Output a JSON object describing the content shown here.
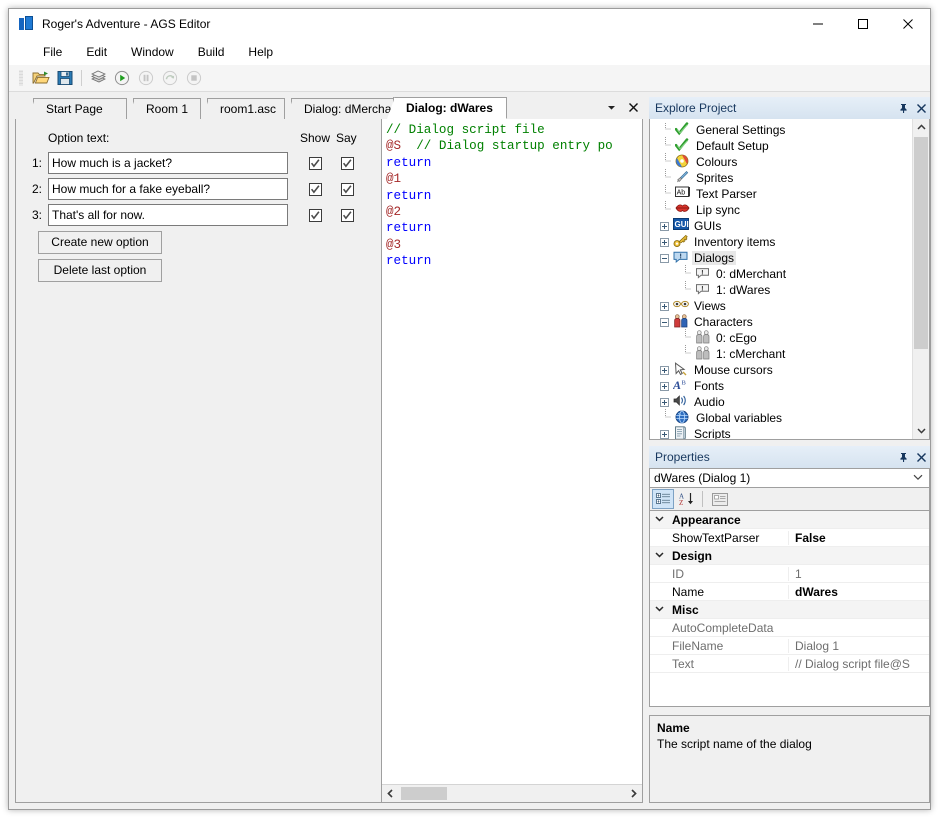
{
  "window": {
    "title": "Roger's Adventure - AGS Editor",
    "icon": "ags-logo-icon",
    "controls": [
      {
        "name": "minimize-button",
        "glyph": "minimize-icon"
      },
      {
        "name": "maximize-button",
        "glyph": "maximize-icon"
      },
      {
        "name": "close-button",
        "glyph": "close-icon"
      }
    ]
  },
  "menubar": {
    "items": [
      {
        "label": "File"
      },
      {
        "label": "Edit"
      },
      {
        "label": "Window"
      },
      {
        "label": "Build"
      },
      {
        "label": "Help"
      }
    ]
  },
  "toolbar": {
    "buttons": [
      {
        "name": "open-project-button",
        "icon": "folder-open-icon",
        "enabled": true
      },
      {
        "name": "save-button",
        "icon": "floppy-disk-icon",
        "enabled": true
      },
      {
        "name": "build-button",
        "icon": "build-blocks-icon",
        "enabled": true
      },
      {
        "name": "run-button",
        "icon": "play-icon",
        "enabled": true
      },
      {
        "name": "pause-button",
        "icon": "pause-icon",
        "enabled": false
      },
      {
        "name": "step-button",
        "icon": "step-over-icon",
        "enabled": false
      },
      {
        "name": "stop-button",
        "icon": "stop-icon",
        "enabled": false
      }
    ]
  },
  "tabs": {
    "items": [
      {
        "label": "Start Page",
        "active": false
      },
      {
        "label": "Room 1",
        "active": false
      },
      {
        "label": "room1.asc",
        "active": false
      },
      {
        "label": "Dialog: dMerchant",
        "active": false
      },
      {
        "label": "Dialog: dWares",
        "active": true
      }
    ],
    "dropdown_icon": "chevron-down-icon",
    "close_icon": "close-icon"
  },
  "dialog_editor": {
    "option_text_header": "Option text:",
    "show_column": "Show",
    "say_column": "Say",
    "options": [
      {
        "number": "1:",
        "text": "How much is a jacket?",
        "show": true,
        "say": true
      },
      {
        "number": "2:",
        "text": "How much for a fake eyeball?",
        "show": true,
        "say": true
      },
      {
        "number": "3:",
        "text": "That's all for now.",
        "show": true,
        "say": true
      }
    ],
    "create_button": "Create new option",
    "delete_button": "Delete last option"
  },
  "script": {
    "lines": [
      {
        "segments": [
          {
            "t": "// Dialog script file",
            "c": "c-comment"
          }
        ]
      },
      {
        "segments": [
          {
            "t": "@S",
            "c": "c-at"
          },
          {
            "t": "  ",
            "c": ""
          },
          {
            "t": "// Dialog startup entry po",
            "c": "c-comment"
          }
        ]
      },
      {
        "segments": [
          {
            "t": "return",
            "c": "c-kw"
          }
        ]
      },
      {
        "segments": [
          {
            "t": "@1",
            "c": "c-at"
          }
        ]
      },
      {
        "segments": [
          {
            "t": "return",
            "c": "c-kw"
          }
        ]
      },
      {
        "segments": [
          {
            "t": "@2",
            "c": "c-at"
          }
        ]
      },
      {
        "segments": [
          {
            "t": "return",
            "c": "c-kw"
          }
        ]
      },
      {
        "segments": [
          {
            "t": "@3",
            "c": "c-at"
          }
        ]
      },
      {
        "segments": [
          {
            "t": "return",
            "c": "c-kw"
          }
        ]
      }
    ],
    "hscroll_left_icon": "chevron-left-icon",
    "hscroll_right_icon": "chevron-right-icon"
  },
  "explore_project": {
    "title": "Explore Project",
    "pin_icon": "pin-icon",
    "close_icon": "close-icon",
    "scroll_up_icon": "chevron-up-icon",
    "scroll_down_icon": "chevron-down-icon",
    "nodes": [
      {
        "label": "General Settings",
        "icon": "green-check-icon",
        "depth": 1,
        "expander": "none",
        "selected": false
      },
      {
        "label": "Default Setup",
        "icon": "green-check-icon",
        "depth": 1,
        "expander": "none",
        "selected": false
      },
      {
        "label": "Colours",
        "icon": "color-palette-icon",
        "depth": 1,
        "expander": "none",
        "selected": false
      },
      {
        "label": "Sprites",
        "icon": "paintbrush-icon",
        "depth": 1,
        "expander": "none",
        "selected": false
      },
      {
        "label": "Text Parser",
        "icon": "text-parser-icon",
        "depth": 1,
        "expander": "none",
        "selected": false
      },
      {
        "label": "Lip sync",
        "icon": "lips-icon",
        "depth": 1,
        "expander": "none",
        "selected": false
      },
      {
        "label": "GUIs",
        "icon": "gui-icon",
        "depth": 1,
        "expander": "plus",
        "selected": false
      },
      {
        "label": "Inventory items",
        "icon": "key-icon",
        "depth": 1,
        "expander": "plus",
        "selected": false
      },
      {
        "label": "Dialogs",
        "icon": "speech-bubble-icon",
        "depth": 1,
        "expander": "minus",
        "selected": true
      },
      {
        "label": "0: dMerchant",
        "icon": "speech-bubble-small-icon",
        "depth": 2,
        "expander": "none",
        "selected": false
      },
      {
        "label": "1: dWares",
        "icon": "speech-bubble-small-icon",
        "depth": 2,
        "expander": "none",
        "selected": false
      },
      {
        "label": "Views",
        "icon": "eyes-icon",
        "depth": 1,
        "expander": "plus",
        "selected": false
      },
      {
        "label": "Characters",
        "icon": "characters-icon",
        "depth": 1,
        "expander": "minus",
        "selected": false
      },
      {
        "label": "0: cEgo",
        "icon": "character-icon",
        "depth": 2,
        "expander": "none",
        "selected": false
      },
      {
        "label": "1: cMerchant",
        "icon": "character-icon",
        "depth": 2,
        "expander": "none",
        "selected": false
      },
      {
        "label": "Mouse cursors",
        "icon": "cursor-arrow-icon",
        "depth": 1,
        "expander": "plus",
        "selected": false
      },
      {
        "label": "Fonts",
        "icon": "font-icon",
        "depth": 1,
        "expander": "plus",
        "selected": false
      },
      {
        "label": "Audio",
        "icon": "speaker-icon",
        "depth": 1,
        "expander": "plus",
        "selected": false
      },
      {
        "label": "Global variables",
        "icon": "globe-icon",
        "depth": 1,
        "expander": "none",
        "selected": false
      },
      {
        "label": "Scripts",
        "icon": "script-icon",
        "depth": 1,
        "expander": "plus",
        "selected": false
      }
    ]
  },
  "properties": {
    "title": "Properties",
    "pin_icon": "pin-icon",
    "close_icon": "close-icon",
    "selected_object": "dWares (Dialog 1)",
    "combo_arrow_icon": "chevron-down-icon",
    "toolbar": [
      {
        "name": "categorized-view-button",
        "icon": "categorized-icon",
        "active": true
      },
      {
        "name": "alphabetical-view-button",
        "icon": "sort-az-icon",
        "active": false
      },
      {
        "name": "property-pages-button",
        "icon": "property-pages-icon",
        "active": false
      }
    ],
    "rows": [
      {
        "kind": "category",
        "name": "Appearance",
        "value": "",
        "chevron": "chevron-down-icon"
      },
      {
        "kind": "prop",
        "name": "ShowTextParser",
        "value": "False",
        "bold_value": true,
        "dim": false
      },
      {
        "kind": "category",
        "name": "Design",
        "value": "",
        "chevron": "chevron-down-icon"
      },
      {
        "kind": "prop",
        "name": "ID",
        "value": "1",
        "bold_value": false,
        "dim": true
      },
      {
        "kind": "prop",
        "name": "Name",
        "value": "dWares",
        "bold_value": true,
        "dim": false
      },
      {
        "kind": "category",
        "name": "Misc",
        "value": "",
        "chevron": "chevron-down-icon"
      },
      {
        "kind": "prop",
        "name": "AutoCompleteData",
        "value": "",
        "bold_value": false,
        "dim": true
      },
      {
        "kind": "prop",
        "name": "FileName",
        "value": "Dialog 1",
        "bold_value": false,
        "dim": true
      },
      {
        "kind": "prop",
        "name": "Text",
        "value": "// Dialog script file@S",
        "bold_value": false,
        "dim": true
      }
    ],
    "description": {
      "title": "Name",
      "text": "The script name of the dialog"
    }
  },
  "colors": {
    "accent": "#17375e",
    "panel": "#f0f0f0",
    "comment": "#008000",
    "keyword": "#0000ff",
    "at_token": "#a52a2a",
    "selection": "#cfe4f7"
  }
}
